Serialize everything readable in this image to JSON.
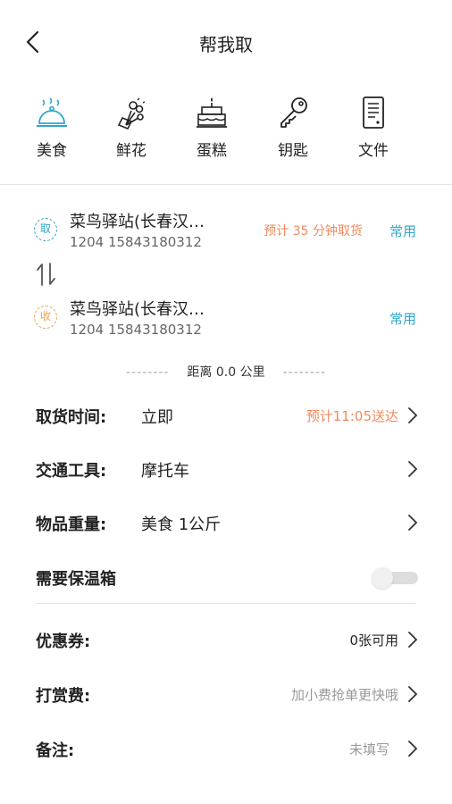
{
  "header": {
    "title": "帮我取"
  },
  "categories": [
    {
      "label": "美食",
      "icon": "food-cover-icon",
      "active": true
    },
    {
      "label": "鲜花",
      "icon": "flower-bouquet-icon",
      "active": false
    },
    {
      "label": "蛋糕",
      "icon": "cake-icon",
      "active": false
    },
    {
      "label": "钥匙",
      "icon": "key-icon",
      "active": false
    },
    {
      "label": "文件",
      "icon": "document-icon",
      "active": false
    }
  ],
  "pickup": {
    "badge": "取",
    "name": "菜鸟驿站(长春汉…",
    "phone": "1204 15843180312",
    "eta": "预计 35 分钟取货",
    "common": "常用"
  },
  "dropoff": {
    "badge": "收",
    "name": "菜鸟驿站(长春汉…",
    "phone": "1204 15843180312",
    "common": "常用"
  },
  "distance": {
    "dash": "--------",
    "text": "距离 0.0 公里"
  },
  "rows": {
    "pickup_time": {
      "key": "取货时间:",
      "value": "立即",
      "right": "预计11:05送达"
    },
    "transport": {
      "key": "交通工具:",
      "value": "摩托车"
    },
    "weight": {
      "key": "物品重量:",
      "value": "美食 1公斤"
    },
    "warm_box": {
      "key": "需要保温箱",
      "enabled": false
    },
    "coupon": {
      "key": "优惠券:",
      "right": "0张可用"
    },
    "tip": {
      "key": "打赏费:",
      "right": "加小费抢单更快哦"
    },
    "remark": {
      "key": "备注:",
      "right": "未填写"
    }
  },
  "colors": {
    "accent": "#2fa7c9",
    "orange": "#f08a5d",
    "text": "#222222",
    "muted": "#999999"
  }
}
